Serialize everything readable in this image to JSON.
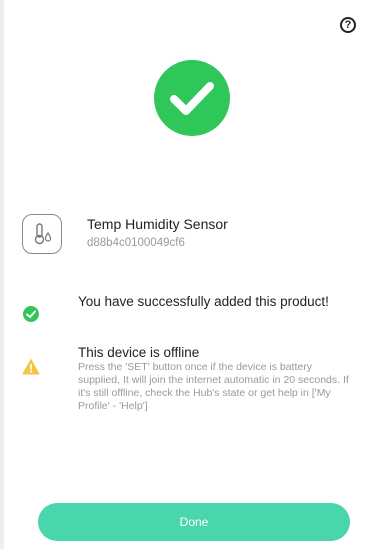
{
  "header": {
    "help_icon": "question-circle-icon",
    "help_glyph": "?"
  },
  "hero": {
    "icon": "check-circle-icon",
    "color": "#2fc65a"
  },
  "device": {
    "icon": "thermometer-humidity-icon",
    "name": "Temp Humidity Sensor",
    "id": "d88b4c0100049cf6"
  },
  "messages": {
    "success": {
      "icon": "check-circle-small-icon",
      "color": "#2fc65a",
      "text": "You have successfully added this product!"
    },
    "offline": {
      "icon": "warning-triangle-icon",
      "color": "#f6c443",
      "title": "This device is offline",
      "body": "Press the 'SET' button once if the device is battery supplied, It will join the internet automatic in 20 seconds. If it's still offline, check the Hub's state or get help in ['My Profile' - 'Help']"
    }
  },
  "footer": {
    "done_label": "Done",
    "button_color": "#49d6ad"
  }
}
